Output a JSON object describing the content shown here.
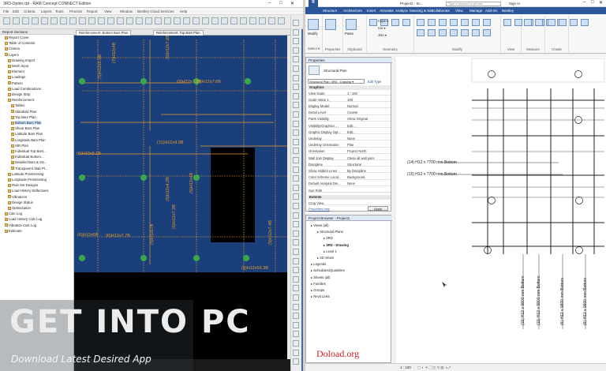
{
  "left_app": {
    "title": "3RD-Optim.cpt - RAM Concept CONNECT Edition",
    "menu": [
      "File",
      "Edit",
      "Criteria",
      "Layers",
      "Tools",
      "Process",
      "Report",
      "View",
      "Window",
      "Bentley Cloud Services",
      "Help"
    ],
    "panel_title": "Report Sections",
    "tree": [
      {
        "label": "Report Cover",
        "depth": 1
      },
      {
        "label": "Table of Contents",
        "depth": 1
      },
      {
        "label": "Criteria",
        "depth": 1
      },
      {
        "label": "Layers",
        "depth": 1
      },
      {
        "label": "Drawing Import",
        "depth": 2
      },
      {
        "label": "Mesh Input",
        "depth": 2
      },
      {
        "label": "Element",
        "depth": 2
      },
      {
        "label": "Loadings",
        "depth": 2
      },
      {
        "label": "Pattern",
        "depth": 2
      },
      {
        "label": "Load Combinations",
        "depth": 2
      },
      {
        "label": "Design Strip",
        "depth": 2
      },
      {
        "label": "Reinforcement",
        "depth": 2
      },
      {
        "label": "Tables",
        "depth": 3
      },
      {
        "label": "Standard Plan",
        "depth": 3
      },
      {
        "label": "Top Bars Plan",
        "depth": 3
      },
      {
        "label": "Bottom Bars Plan",
        "depth": 3,
        "selected": true
      },
      {
        "label": "Shear Bars Plan",
        "depth": 3
      },
      {
        "label": "Latitude Bars Plan",
        "depth": 3
      },
      {
        "label": "Longitude Bars Plan",
        "depth": 3
      },
      {
        "label": "SIR Plan",
        "depth": 3
      },
      {
        "label": "Individual Top Bars...",
        "depth": 3
      },
      {
        "label": "Individual Bottom...",
        "depth": 3
      },
      {
        "label": "Detailed Bars & SS...",
        "depth": 3
      },
      {
        "label": "Transparent Slab Pl...",
        "depth": 3
      },
      {
        "label": "Latitude Prestressing",
        "depth": 2
      },
      {
        "label": "Longitude Prestressing",
        "depth": 2
      },
      {
        "label": "Rule Set Designs",
        "depth": 2
      },
      {
        "label": "Load History Deflections",
        "depth": 2
      },
      {
        "label": "Vibrations",
        "depth": 2
      },
      {
        "label": "Design Status",
        "depth": 2
      },
      {
        "label": "Optimization",
        "depth": 2
      },
      {
        "label": "Calc Log",
        "depth": 1
      },
      {
        "label": "Load History Calc Log",
        "depth": 1
      },
      {
        "label": "Vibration Calc Log",
        "depth": 1
      },
      {
        "label": "Estimate",
        "depth": 1
      }
    ],
    "tabs": [
      "Reinforcement: Bottom Bars Plan",
      "Reinforcement: Top Bars Plan"
    ],
    "plan_labels": [
      {
        "t": "(5)H12x5.5B",
        "r": -90
      },
      {
        "t": "(7)H12x4B",
        "r": -90
      },
      {
        "t": "(5)H12x7.6B",
        "r": -90
      },
      {
        "t": "(3)H12x7.6B",
        "r": 0
      },
      {
        "t": "(9)H12x7.2B",
        "r": 0
      },
      {
        "t": "(11)H12x9.9B",
        "r": 0
      },
      {
        "t": "(6)H10x8.1B",
        "r": 0
      },
      {
        "t": "(5)H12x4B",
        "r": -90
      },
      {
        "t": "(5)H12x4.2B",
        "r": -90
      },
      {
        "t": "(6)H12x6B",
        "r": 0
      },
      {
        "t": "(6)H12x7.7B",
        "r": 0
      },
      {
        "t": "(5)H12x7B",
        "r": -90
      },
      {
        "t": "(5)H12x7.2B",
        "r": -90
      },
      {
        "t": "(5)H12x7.4B",
        "r": -90
      },
      {
        "t": "(5)H12x56.3B",
        "r": 0
      }
    ]
  },
  "right_app": {
    "title": "Project1 - St...",
    "search_placeholder": "Type a keyword or phrase",
    "sign_in": "Sign In",
    "ribbon_tabs": [
      "Structure",
      "Architecture",
      "Insert",
      "Annotate",
      "Analyze",
      "Massing & Site",
      "Collaborate",
      "View",
      "Manage",
      "Add-Ins",
      "Bentley"
    ],
    "ribbon_groups": [
      "Select ▾",
      "Properties",
      "Clipboard",
      "Geometry",
      "Modify",
      "View",
      "Measure",
      "Create"
    ],
    "clipboard": [
      "Cope ▾",
      "Cut ▾",
      "Join ▾"
    ],
    "ribbon_buttons": [
      "Modify",
      "Paste"
    ],
    "properties": {
      "title": "Properties",
      "type": "Structural Plan",
      "selector": "Structural Plan: 3RD - Drawing ▾",
      "edit_type": "Edit Type",
      "section": "Graphics",
      "rows": [
        [
          "View Scale",
          "1 : 100"
        ],
        [
          "Scale Value 1:",
          "100"
        ],
        [
          "Display Model",
          "Normal"
        ],
        [
          "Detail Level",
          "Coarse"
        ],
        [
          "Parts Visibility",
          "Show Original"
        ],
        [
          "Visibility/Graphics ...",
          "Edit..."
        ],
        [
          "Graphic Display Opt...",
          "Edit..."
        ],
        [
          "Underlay",
          "None"
        ],
        [
          "Underlay Orientation",
          "Plan"
        ],
        [
          "Orientation",
          "Project North"
        ],
        [
          "Wall Join Display",
          "Clean all wall joins"
        ],
        [
          "Discipline",
          "Structural"
        ],
        [
          "Show Hidden Lines",
          "By Discipline"
        ],
        [
          "Color Scheme Locat...",
          "Background"
        ],
        [
          "Default Analysis Dis...",
          "None"
        ],
        [
          "Sun Path",
          ""
        ]
      ],
      "section2": "Extents",
      "rows2": [
        [
          "Crop View",
          ""
        ],
        [
          "Crop Region Visible",
          ""
        ]
      ],
      "help": "Properties help",
      "apply": "Apply"
    },
    "browser": {
      "title": "Project Browser - Project1",
      "items": [
        {
          "l": "Views (all)",
          "d": 0
        },
        {
          "l": "Structural Plans",
          "d": 1
        },
        {
          "l": "3RD",
          "d": 2
        },
        {
          "l": "3RD - Drawing",
          "d": 2,
          "b": true
        },
        {
          "l": "Level 1",
          "d": 2
        },
        {
          "l": "3D Views",
          "d": 1
        },
        {
          "l": "Legends",
          "d": 0
        },
        {
          "l": "Schedules/Quantities",
          "d": 0
        },
        {
          "l": "Sheets (all)",
          "d": 0
        },
        {
          "l": "Families",
          "d": 0
        },
        {
          "l": "Groups",
          "d": 0
        },
        {
          "l": "Revit Links",
          "d": 0
        }
      ]
    },
    "view_labels": {
      "h1": "(14) H12 x 7700 mm Bottom",
      "h2": "(15) H12 x 7700 mm Bottom",
      "v": [
        "(11) H12 x 9800 mm Bottom",
        "(11) H12 x 9800 mm Bottom",
        "(6) H12 x 9800 mm Bottom",
        "(6) H12 x 9800 mm Bottom"
      ]
    },
    "status_scale": "1 : 100"
  },
  "watermark": {
    "big": "GET INTO PC",
    "small": "Download Latest Desired App"
  },
  "doload": "Doload.org",
  "colors": {
    "accent": "#2b579a",
    "plan_blue": "#1b3f7a",
    "rebar": "#e89a2a"
  }
}
